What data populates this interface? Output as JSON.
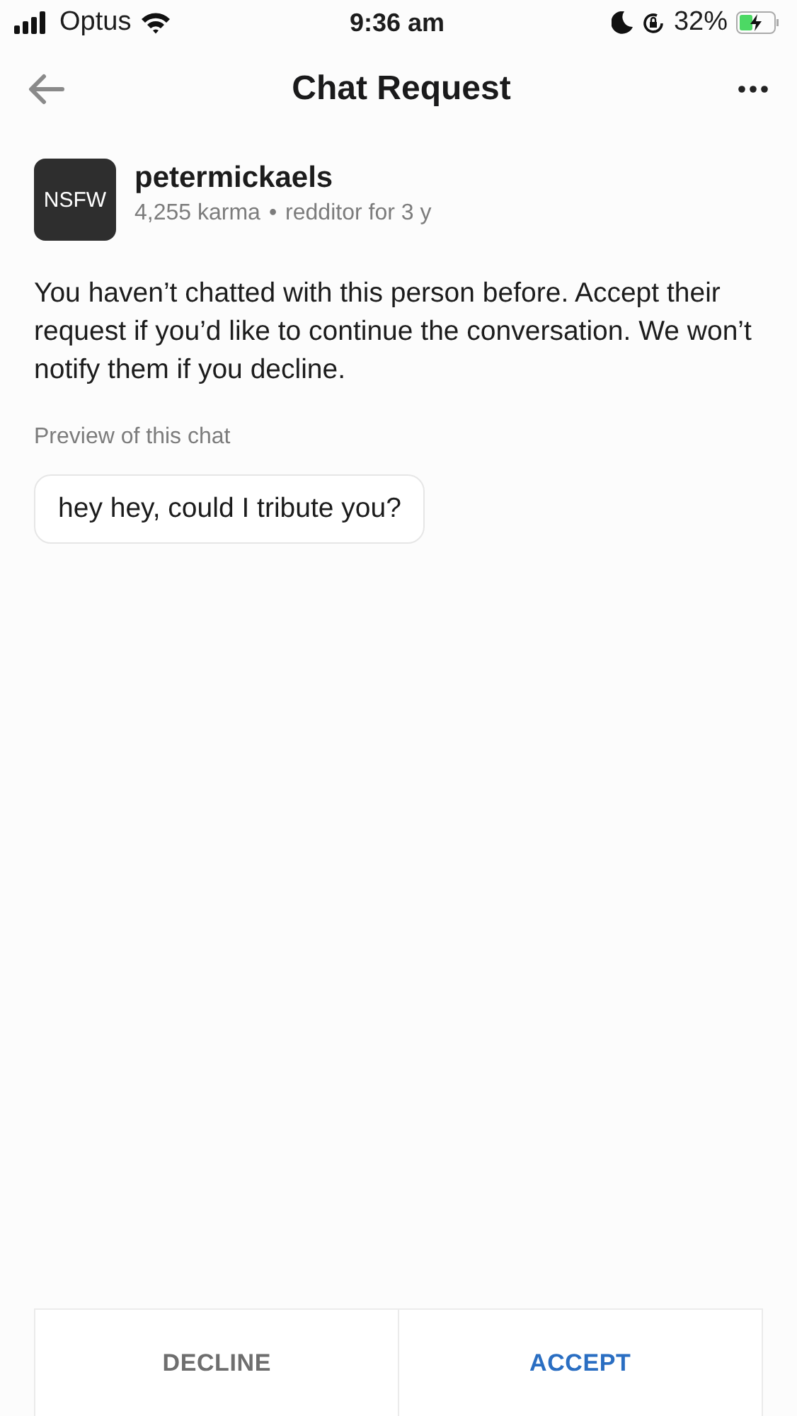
{
  "status_bar": {
    "carrier": "Optus",
    "time": "9:36 am",
    "battery": "32%"
  },
  "header": {
    "title": "Chat Request"
  },
  "profile": {
    "avatar_label": "NSFW",
    "username": "petermickaels",
    "karma": "4,255 karma",
    "separator": "•",
    "age": "redditor for 3 y"
  },
  "notice": "You haven’t chatted with this person before. Accept their request if you’d like to continue the conversation. We won’t notify them if you decline.",
  "preview": {
    "label": "Preview of this chat",
    "message": "hey hey, could I tribute you?"
  },
  "buttons": [
    {
      "label": "DECLINE",
      "kind": "secondary"
    },
    {
      "label": "ACCEPT",
      "kind": "primary"
    }
  ]
}
